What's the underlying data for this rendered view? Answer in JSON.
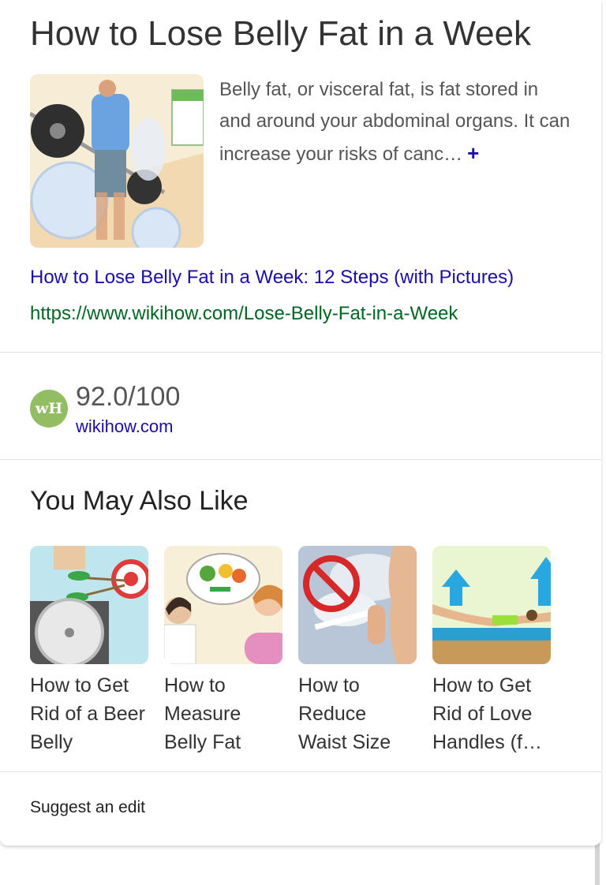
{
  "title": "How to Lose Belly Fat in a Week",
  "description": "Belly fat, or visceral fat, is fat stored in and around your abdominal organs. It can increase your risks of canc…",
  "more_glyph": "+",
  "result_link": "How to Lose Belly Fat in a Week: 12 Steps (with Pictures)",
  "result_url": "https://www.wikihow.com/Lose-Belly-Fat-in-a-Week",
  "rating": {
    "logo_text": "wH",
    "score": "92.0/100",
    "source": "wikihow.com"
  },
  "related": {
    "title": "You May Also Like",
    "items": [
      {
        "label": "How to Get Rid of a Beer Belly",
        "icon": "dartboard-scale-icon"
      },
      {
        "label": "How to Measure Belly Fat",
        "icon": "doctor-patient-icon"
      },
      {
        "label": "How to Reduce Waist Size",
        "icon": "no-smoking-icon"
      },
      {
        "label": "How to Get Rid of Love Handles (f…",
        "icon": "superman-exercise-icon"
      }
    ]
  },
  "suggest_edit": "Suggest an edit",
  "colors": {
    "link": "#1a0dab",
    "url": "#006621",
    "logo_bg": "#93bd63"
  }
}
